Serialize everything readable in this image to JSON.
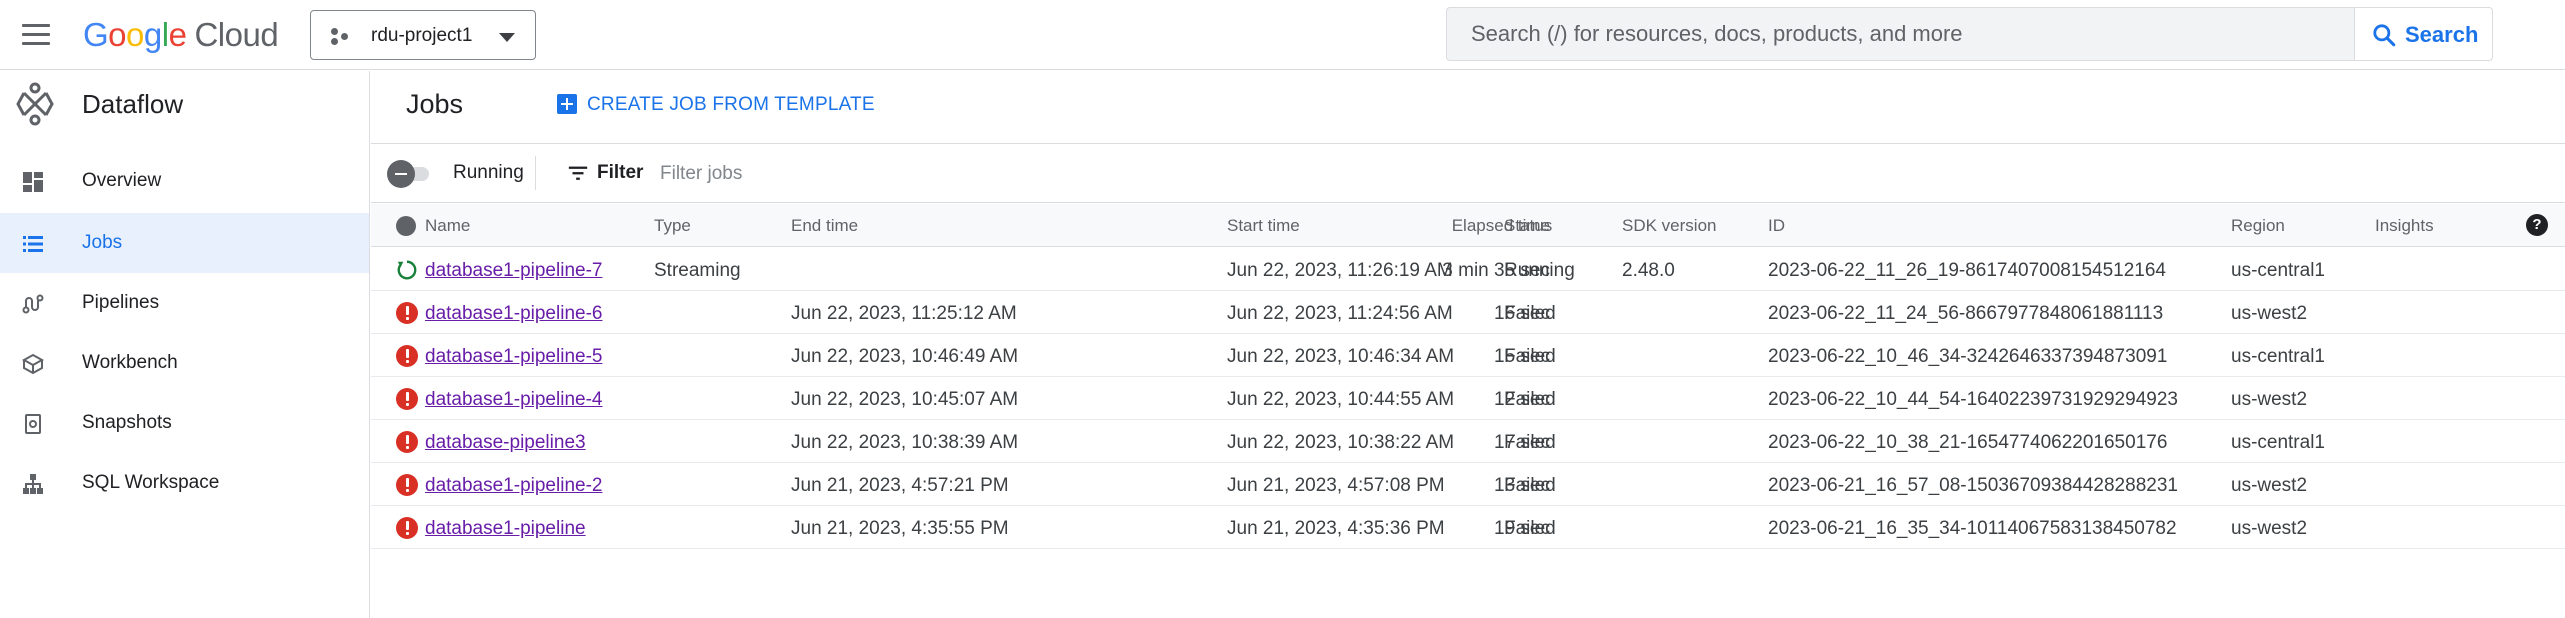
{
  "header": {
    "logo_letters": [
      "G",
      "o",
      "o",
      "g",
      "l",
      "e"
    ],
    "logo_cloud": "Cloud",
    "project_name": "rdu-project1",
    "search_placeholder": "Search (/) for resources, docs, products, and more",
    "search_button": "Search"
  },
  "sidebar": {
    "product_title": "Dataflow",
    "items": [
      {
        "label": "Overview",
        "icon": "dashboard-icon",
        "active": false
      },
      {
        "label": "Jobs",
        "icon": "list-icon",
        "active": true
      },
      {
        "label": "Pipelines",
        "icon": "pipelines-icon",
        "active": false
      },
      {
        "label": "Workbench",
        "icon": "workbench-icon",
        "active": false
      },
      {
        "label": "Snapshots",
        "icon": "snapshots-icon",
        "active": false
      },
      {
        "label": "SQL Workspace",
        "icon": "sql-workspace-icon",
        "active": false
      }
    ]
  },
  "main": {
    "title": "Jobs",
    "create_button": "CREATE JOB FROM TEMPLATE",
    "toggle_label": "Running",
    "filter_label": "Filter",
    "filter_placeholder": "Filter jobs"
  },
  "table": {
    "columns": [
      "Name",
      "Type",
      "End time",
      "Elapsed time",
      "Start time",
      "Status",
      "SDK version",
      "ID",
      "Region",
      "Insights"
    ],
    "rows": [
      {
        "status_icon": "running-icon",
        "name": "database1-pipeline-7",
        "type": "Streaming",
        "end_time": "",
        "elapsed": "3 min 35 sec",
        "start_time": "Jun 22, 2023, 11:26:19 AM",
        "status": "Running",
        "sdk": "2.48.0",
        "id": "2023-06-22_11_26_19-8617407008154512164",
        "region": "us-central1"
      },
      {
        "status_icon": "error-icon",
        "name": "database1-pipeline-6",
        "type": "",
        "end_time": "Jun 22, 2023, 11:25:12 AM",
        "elapsed": "16 sec",
        "start_time": "Jun 22, 2023, 11:24:56 AM",
        "status": "Failed",
        "sdk": "",
        "id": "2023-06-22_11_24_56-8667977848061881113",
        "region": "us-west2"
      },
      {
        "status_icon": "error-icon",
        "name": "database1-pipeline-5",
        "type": "",
        "end_time": "Jun 22, 2023, 10:46:49 AM",
        "elapsed": "15 sec",
        "start_time": "Jun 22, 2023, 10:46:34 AM",
        "status": "Failed",
        "sdk": "",
        "id": "2023-06-22_10_46_34-3242646337394873091",
        "region": "us-central1"
      },
      {
        "status_icon": "error-icon",
        "name": "database1-pipeline-4",
        "type": "",
        "end_time": "Jun 22, 2023, 10:45:07 AM",
        "elapsed": "12 sec",
        "start_time": "Jun 22, 2023, 10:44:55 AM",
        "status": "Failed",
        "sdk": "",
        "id": "2023-06-22_10_44_54-16402239731929294923",
        "region": "us-west2"
      },
      {
        "status_icon": "error-icon",
        "name": "database-pipeline3",
        "type": "",
        "end_time": "Jun 22, 2023, 10:38:39 AM",
        "elapsed": "17 sec",
        "start_time": "Jun 22, 2023, 10:38:22 AM",
        "status": "Failed",
        "sdk": "",
        "id": "2023-06-22_10_38_21-1654774062201650176",
        "region": "us-central1"
      },
      {
        "status_icon": "error-icon",
        "name": "database1-pipeline-2",
        "type": "",
        "end_time": "Jun 21, 2023, 4:57:21 PM",
        "elapsed": "13 sec",
        "start_time": "Jun 21, 2023, 4:57:08 PM",
        "status": "Failed",
        "sdk": "",
        "id": "2023-06-21_16_57_08-15036709384428288231",
        "region": "us-west2"
      },
      {
        "status_icon": "error-icon",
        "name": "database1-pipeline",
        "type": "",
        "end_time": "Jun 21, 2023, 4:35:55 PM",
        "elapsed": "19 sec",
        "start_time": "Jun 21, 2023, 4:35:36 PM",
        "status": "Failed",
        "sdk": "",
        "id": "2023-06-21_16_35_34-10114067583138450782",
        "region": "us-west2"
      }
    ]
  },
  "colors": {
    "accent": "#1a73e8",
    "error": "#d93025",
    "running": "#188038",
    "link_visited": "#681da8"
  }
}
